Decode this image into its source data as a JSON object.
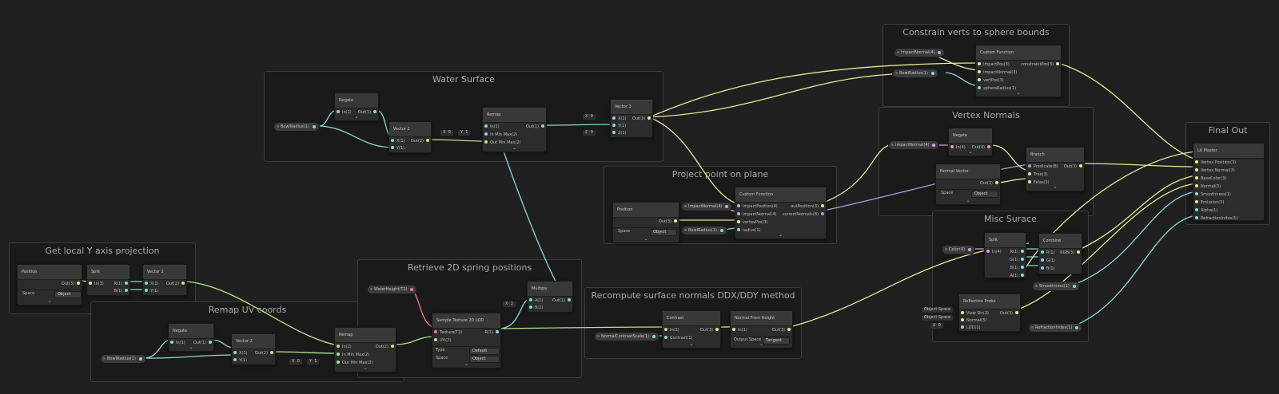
{
  "colors": {
    "cyan": "#8fd6d6",
    "yellow": "#e8e89c",
    "lime": "#b6e68a",
    "green": "#8fe08f",
    "red": "#e8807a",
    "purple": "#a89ce0",
    "pink": "#e09ce0"
  },
  "groups": {
    "water_surface": "Water Surface",
    "constrain": "Constrain verts to sphere bounds",
    "vertex_normals": "Vertex Normals",
    "project_point": "Project point on plane",
    "final_out": "Final Out",
    "misc_surace": "Misc Surace",
    "local_y": "Get local Y axis projection",
    "remap_uv": "Remap UV coords",
    "spring": "Retrieve 2D spring positions",
    "recompute": "Recompute surface normals DDX/DDY method"
  },
  "properties": {
    "bowl_radius": "BowlRadius(1)",
    "impact_normal": "ImpactNormal(4)",
    "water_height": "WaterHeight(T2)",
    "color": "Color(4)",
    "smoothness": "Smoothness(1)",
    "refraction_index": "RefractionIndex(1)",
    "normal_contrast": "NormalContrastScale(1)"
  },
  "nodes": {
    "negate": {
      "title": "Negate",
      "in": "In(1)",
      "out": "Out(1)"
    },
    "negate4": {
      "title": "Negate",
      "in": "In(4)",
      "out": "Out(4)"
    },
    "vector2": {
      "title": "Vector 2",
      "x": "X(1)",
      "y": "Y(1)",
      "out": "Out(2)"
    },
    "vector3": {
      "title": "Vector 3",
      "x": "X(1)",
      "y": "Y(1)",
      "z": "Z(1)",
      "out": "Out(3)"
    },
    "remap": {
      "title": "Remap",
      "in1": "In(1)",
      "in2": "In(2)",
      "inminmax": "In Min Max(2)",
      "outminmax": "Out Min Max(2)",
      "out1": "Out(1)",
      "out2": "Out(2)"
    },
    "custom_constrain": {
      "title": "Custom Function",
      "in": [
        "impactPos(3)",
        "impactNormal(3)",
        "vertPos(3)",
        "sphereRadius(1)"
      ],
      "out": "constraintPos(3)"
    },
    "custom_project": {
      "title": "Custom Function",
      "in": [
        "impactPosition(4)",
        "impactNormal(4)",
        "vertexPos(3)",
        "radius(1)"
      ],
      "out": [
        "outPosition(3)",
        "correctNormals(8)"
      ]
    },
    "branch": {
      "title": "Branch",
      "in": [
        "Predicate(B)",
        "True(3)",
        "False(3)"
      ],
      "out": "Out(3)"
    },
    "normal_vector": {
      "title": "Normal Vector",
      "out": "Out(3)",
      "space_label": "Space",
      "space_value": "Object"
    },
    "position": {
      "title": "Position",
      "out": "Out(3)",
      "space_label": "Space",
      "space_value": "Object"
    },
    "lit_master": {
      "title": "Lit Master",
      "in": [
        "Vertex Position(3)",
        "Vertex Normal(3)",
        "BaseColor(3)",
        "Normal(3)",
        "Smoothness(1)",
        "Emission(3)",
        "Alpha(1)",
        "RefractionIndex(1)"
      ]
    },
    "split": {
      "title": "Split",
      "in3": "In(3)",
      "in4": "In(4)",
      "r": "R(1)",
      "g": "G(1)",
      "b": "B(1)",
      "a": "A(1)"
    },
    "combine": {
      "title": "Combine",
      "in": [
        "R(1)",
        "G(1)",
        "B(1)"
      ],
      "out": "RGB(3)"
    },
    "reflection_probe": {
      "title": "Reflection Probe",
      "in": [
        "View Dir(3)",
        "Normal(3)",
        "LOD(1)"
      ],
      "out": "Out(3)",
      "inline": [
        "Object Space",
        "Object Space"
      ]
    },
    "multiply": {
      "title": "Multiply",
      "a": "A(1)",
      "b": "B(1)",
      "out": "Out(1)"
    },
    "sample_tex": {
      "title": "Sample Texture 2D LOD",
      "in": [
        "Texture(T2)",
        "UV(2)"
      ],
      "out": "R(1)",
      "type_label": "Type",
      "type_value": "Default",
      "space_label": "Space",
      "space_value": "Object"
    },
    "contrast": {
      "title": "Contrast",
      "in": [
        "In(1)",
        "Contrast(1)"
      ],
      "out": "Out(3)"
    },
    "normal_from_height": {
      "title": "Normal From Height",
      "in": "In(1)",
      "out": "Out(3)",
      "space_label": "Output Space",
      "space_value": "Tangent"
    }
  },
  "inline": {
    "x": "X",
    "y": "Y",
    "z": "Z",
    "zero": "0",
    "one": "1"
  },
  "chevron": "⌄"
}
